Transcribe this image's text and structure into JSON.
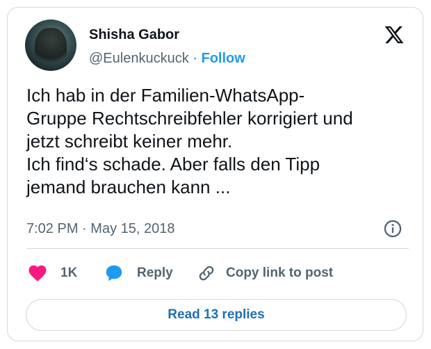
{
  "author": {
    "name": "Shisha Gabor",
    "handle": "@Eulenkuckuck",
    "separator": "·",
    "follow_label": "Follow"
  },
  "tweet": {
    "text": "Ich hab in der Familien-WhatsApp-\nGruppe Rechtschreibfehler korrigiert und\njetzt schreibt keiner mehr.\nIch find‘s schade. Aber falls den Tipp\njemand brauchen kann ...",
    "time": "7:02 PM",
    "separator": "·",
    "date": "May 15, 2018"
  },
  "actions": {
    "likes_count": "1K",
    "reply_label": "Reply",
    "copy_label": "Copy link to post"
  },
  "read_replies_label": "Read 13 replies",
  "icons": {
    "logo": "x-logo-icon",
    "info": "info-icon",
    "like": "heart-icon",
    "reply": "speech-bubble-icon",
    "copy": "link-icon"
  },
  "colors": {
    "accent": "#1d9bf0",
    "heart": "#f91880",
    "text": "#0f1419",
    "muted": "#536471"
  }
}
